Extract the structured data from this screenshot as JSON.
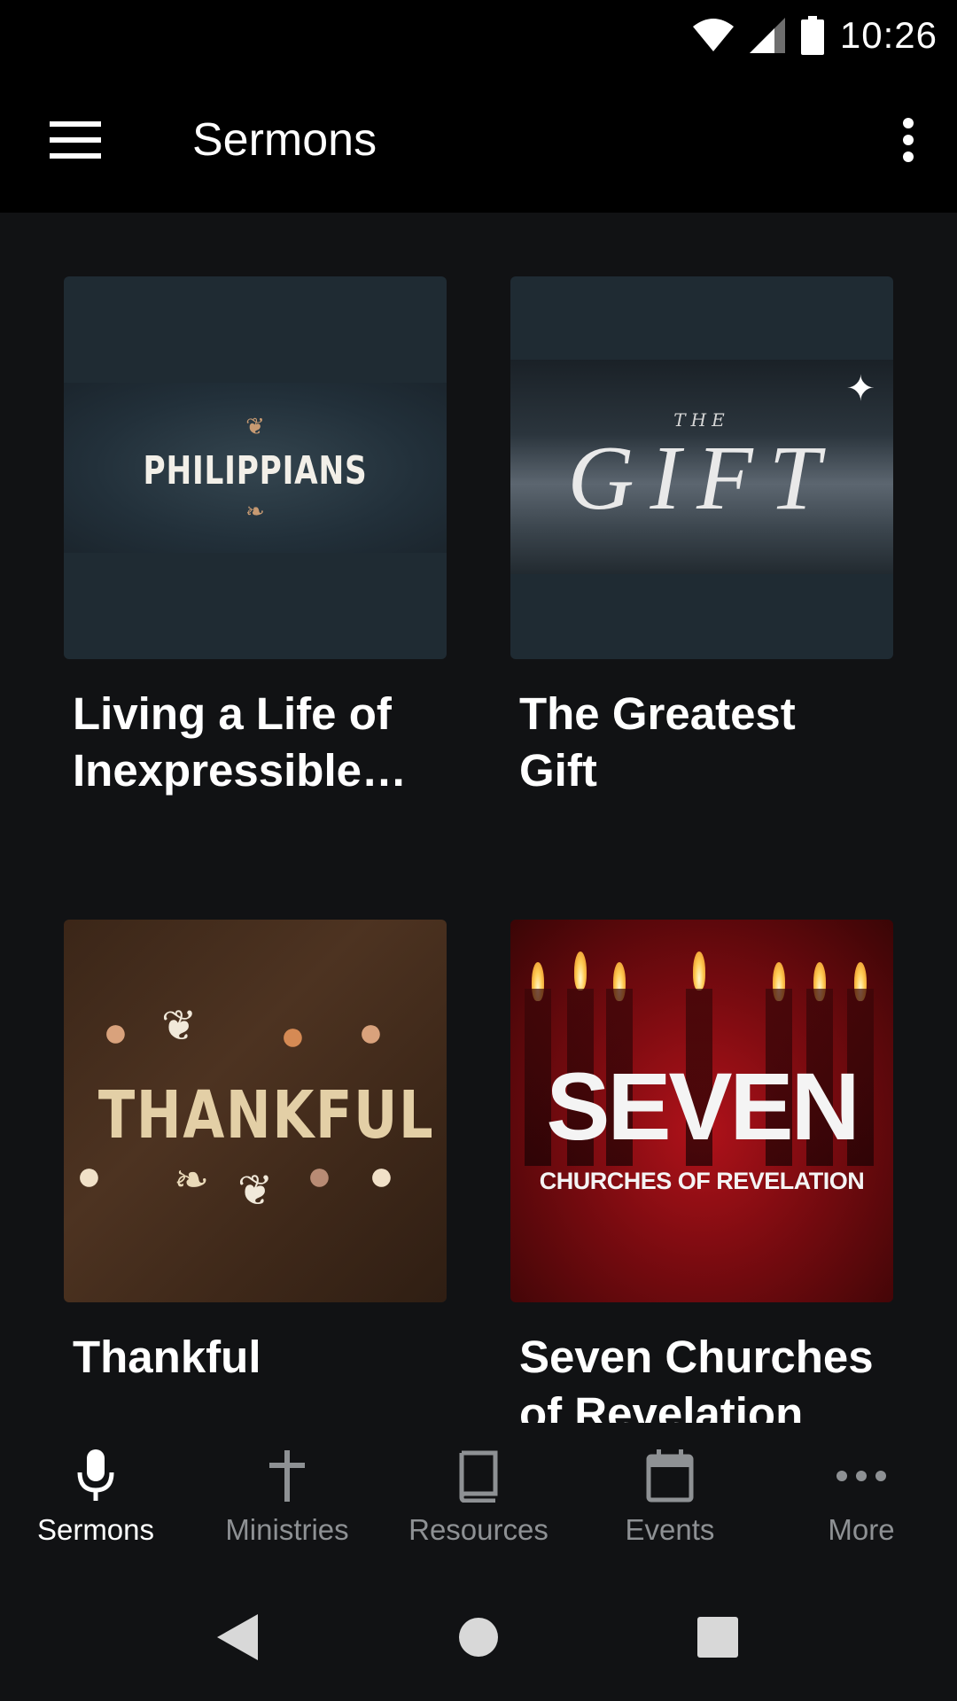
{
  "status_bar": {
    "time": "10:26"
  },
  "app_bar": {
    "title": "Sermons"
  },
  "sermons": [
    {
      "title": "Living a Life of Inexpressible a…",
      "thumb_text": "PHILIPPIANS"
    },
    {
      "title": "The Greatest Gift",
      "thumb_text": "GIFT",
      "thumb_sub": "THE"
    },
    {
      "title": "Thankful",
      "thumb_text": "THANKFUL"
    },
    {
      "title": "Seven Churches of Revelation",
      "thumb_text": "SEVEN",
      "thumb_sub": "CHURCHES OF REVELATION"
    }
  ],
  "bottom_nav": [
    {
      "label": "Sermons",
      "icon": "microphone-icon",
      "active": true
    },
    {
      "label": "Ministries",
      "icon": "cross-icon"
    },
    {
      "label": "Resources",
      "icon": "book-icon"
    },
    {
      "label": "Events",
      "icon": "calendar-icon"
    },
    {
      "label": "More",
      "icon": "more-horizontal-icon"
    }
  ],
  "colors": {
    "background": "#111214",
    "bar": "#000000",
    "inactive": "#8e9194",
    "active": "#ffffff"
  }
}
